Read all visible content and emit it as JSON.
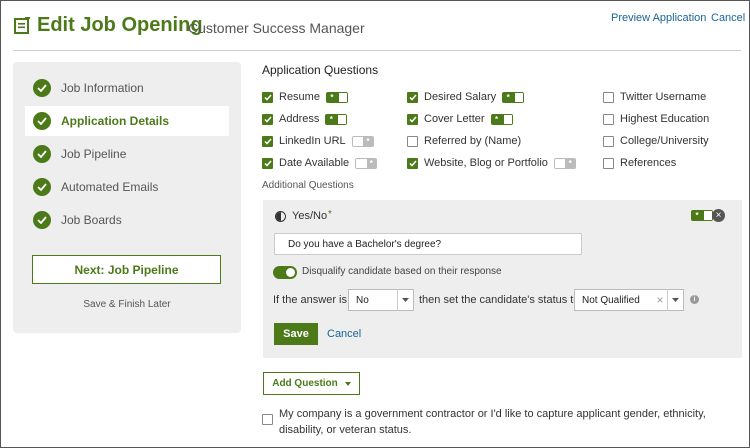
{
  "header": {
    "title": "Edit Job Opening",
    "subtitle": "Customer Success Manager",
    "preview_label": "Preview Application",
    "cancel_label": "Cancel"
  },
  "sidebar": {
    "steps": [
      {
        "label": "Job Information",
        "done": true,
        "active": false
      },
      {
        "label": "Application Details",
        "done": true,
        "active": true
      },
      {
        "label": "Job Pipeline",
        "done": true,
        "active": false
      },
      {
        "label": "Automated Emails",
        "done": true,
        "active": false
      },
      {
        "label": "Job Boards",
        "done": true,
        "active": false
      }
    ],
    "next_label": "Next: Job Pipeline",
    "save_later_label": "Save & Finish Later"
  },
  "questions": {
    "title": "Application Questions",
    "items": [
      {
        "label": "Resume",
        "checked": true,
        "required": true
      },
      {
        "label": "Address",
        "checked": true,
        "required": true
      },
      {
        "label": "LinkedIn URL",
        "checked": true,
        "required": false
      },
      {
        "label": "Date Available",
        "checked": true,
        "required": false
      },
      {
        "label": "Desired Salary",
        "checked": true,
        "required": true
      },
      {
        "label": "Cover Letter",
        "checked": true,
        "required": true
      },
      {
        "label": "Referred by (Name)",
        "checked": false
      },
      {
        "label": "Website, Blog or Portfolio",
        "checked": true,
        "required": false
      },
      {
        "label": "Twitter Username",
        "checked": false
      },
      {
        "label": "Highest Education",
        "checked": false
      },
      {
        "label": "College/University",
        "checked": false
      },
      {
        "label": "References",
        "checked": false
      }
    ],
    "toggle_glyph": "*"
  },
  "additional": {
    "label": "Additional Questions",
    "type_label": "Yes/No",
    "required_mark": "*",
    "question_value": "Do you have a Bachelor's degree?",
    "disqualify_label": "Disqualify candidate based on their response",
    "disqualify_on": true,
    "cond_if": "If the answer is",
    "answer_value": "No",
    "cond_then": "then set the candidate's status to",
    "status_value": "Not Qualified",
    "save_label": "Save",
    "cancel_label": "Cancel"
  },
  "add_question_label": "Add Question",
  "gov": {
    "checked": false,
    "text": "My company is a government contractor or I'd like to capture applicant gender, ethnicity, disability, or veteran status."
  },
  "colors": {
    "brand": "#4c7a19",
    "link": "#1a6496"
  }
}
